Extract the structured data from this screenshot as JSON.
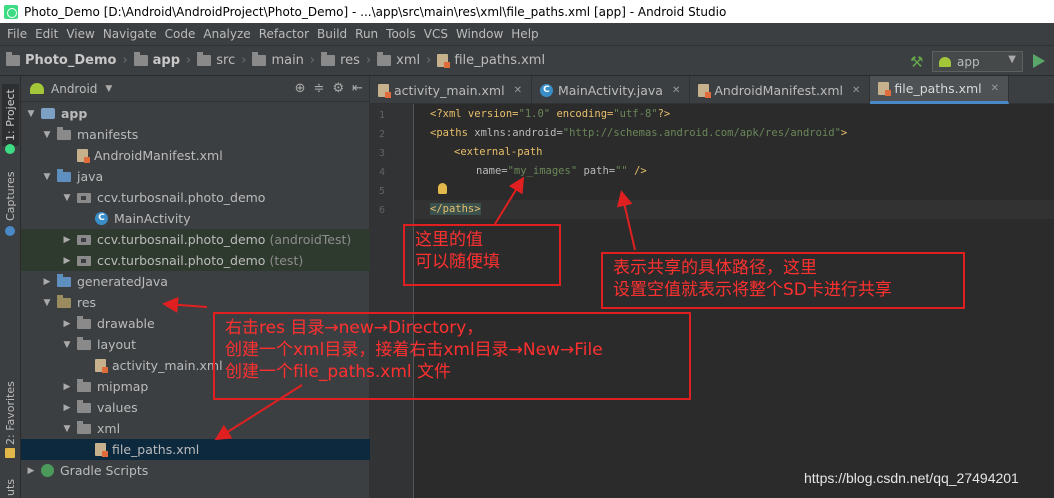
{
  "window": {
    "title": "Photo_Demo [D:\\Android\\AndroidProject\\Photo_Demo] - ...\\app\\src\\main\\res\\xml\\file_paths.xml [app] - Android Studio"
  },
  "menu": [
    "File",
    "Edit",
    "View",
    "Navigate",
    "Code",
    "Analyze",
    "Refactor",
    "Build",
    "Run",
    "Tools",
    "VCS",
    "Window",
    "Help"
  ],
  "breadcrumb": [
    "Photo_Demo",
    "app",
    "src",
    "main",
    "res",
    "xml",
    "file_paths.xml"
  ],
  "run_config": {
    "label": "app"
  },
  "stripe": {
    "project_tab": "1: Project",
    "captures_tab": "Captures",
    "favorites_tab": "2: Favorites",
    "structure_tab": "uts"
  },
  "project_panel": {
    "view_mode": "Android",
    "tree": [
      {
        "label": "app",
        "extra": ""
      },
      {
        "label": "manifests",
        "extra": ""
      },
      {
        "label": "AndroidManifest.xml",
        "extra": ""
      },
      {
        "label": "java",
        "extra": ""
      },
      {
        "label": "ccv.turbosnail.photo_demo",
        "extra": ""
      },
      {
        "label": "MainActivity",
        "extra": ""
      },
      {
        "label": "ccv.turbosnail.photo_demo",
        "extra": "(androidTest)"
      },
      {
        "label": "ccv.turbosnail.photo_demo",
        "extra": "(test)"
      },
      {
        "label": "generatedJava",
        "extra": ""
      },
      {
        "label": "res",
        "extra": ""
      },
      {
        "label": "drawable",
        "extra": ""
      },
      {
        "label": "layout",
        "extra": ""
      },
      {
        "label": "activity_main.xml",
        "extra": ""
      },
      {
        "label": "mipmap",
        "extra": ""
      },
      {
        "label": "values",
        "extra": ""
      },
      {
        "label": "xml",
        "extra": ""
      },
      {
        "label": "file_paths.xml",
        "extra": ""
      },
      {
        "label": "Gradle Scripts",
        "extra": ""
      }
    ]
  },
  "editor": {
    "tabs": [
      "activity_main.xml",
      "MainActivity.java",
      "AndroidManifest.xml",
      "file_paths.xml"
    ],
    "active_tab": "file_paths.xml",
    "line_numbers": [
      "1",
      "2",
      "3",
      "4",
      "5",
      "6"
    ],
    "code": {
      "l1_pi": "<?xml version=",
      "l1_v1": "\"1.0\"",
      "l1_mid": " encoding=",
      "l1_v2": "\"utf-8\"",
      "l1_end": "?>",
      "l2_tag": "<paths",
      "l2_attr": " xmlns:android=",
      "l2_val": "\"http://schemas.android.com/apk/res/android\"",
      "l2_end": ">",
      "l3_tag": "<external-path",
      "l4_attr1": "name=",
      "l4_val1": "\"my_images\"",
      "l4_attr2": " path=",
      "l4_val2": "\"\"",
      "l4_end": " />",
      "l6_tag": "</paths>"
    }
  },
  "annotations": {
    "note1": [
      "这里的值",
      "可以随便填"
    ],
    "note2": [
      "表示共享的具体路径，这里",
      "设置空值就表示将整个SD卡进行共享"
    ],
    "note3": [
      "右击res 目录→new→Directory，",
      "创建一个xml目录，接着右击xml目录→New→File",
      "创建一个file_paths.xml 文件"
    ]
  },
  "watermark": "https://blog.csdn.net/qq_27494201",
  "colors": {
    "accent": "#4a88c7",
    "annotation": "#e02020",
    "selection": "#0d293e"
  }
}
